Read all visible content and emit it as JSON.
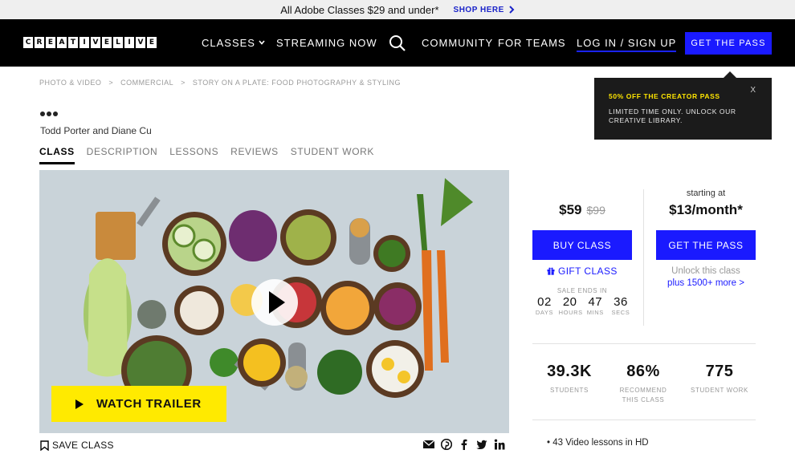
{
  "promo": {
    "text": "All Adobe Classes $29 and under*",
    "link": "SHOP HERE"
  },
  "nav": {
    "logo_letters": [
      "C",
      "R",
      "E",
      "A",
      "T",
      "I",
      "V",
      "E",
      "L",
      "I",
      "V",
      "E"
    ],
    "classes": "CLASSES",
    "streaming": "STREAMING NOW",
    "community": "COMMUNITY",
    "teams": "FOR TEAMS",
    "login": "LOG IN / SIGN UP",
    "get_pass": "GET THE PASS"
  },
  "breadcrumbs": [
    "PHOTO & VIDEO",
    ">",
    "COMMERCIAL",
    ">",
    "STORY ON A PLATE: FOOD PHOTOGRAPHY & STYLING"
  ],
  "popup": {
    "title": "50% OFF THE CREATOR PASS",
    "text": "LIMITED TIME ONLY. UNLOCK OUR CREATIVE LIBRARY.",
    "close": "X"
  },
  "authors": "Todd Porter and Diane Cu",
  "tabs": [
    "CLASS",
    "DESCRIPTION",
    "LESSONS",
    "REVIEWS",
    "STUDENT WORK"
  ],
  "hero": {
    "trailer": "WATCH TRAILER"
  },
  "save_class": "SAVE CLASS",
  "pricing": {
    "price": "$59",
    "old_price": "$99",
    "starting": "starting at",
    "monthly": "$13/month*",
    "buy": "BUY CLASS",
    "get_pass": "GET THE PASS",
    "gift": "GIFT CLASS",
    "sale_ends": "SALE ENDS IN",
    "countdown": [
      {
        "num": "02",
        "label": "DAYS"
      },
      {
        "num": "20",
        "label": "HOURS"
      },
      {
        "num": "47",
        "label": "MINS"
      },
      {
        "num": "36",
        "label": "SECS"
      }
    ],
    "unlock": "Unlock this class",
    "more": "plus 1500+ more >"
  },
  "stats": [
    {
      "value": "39.3K",
      "label": "STUDENTS"
    },
    {
      "value": "86%",
      "label": "RECOMMEND THIS CLASS"
    },
    {
      "value": "775",
      "label": "STUDENT WORK"
    }
  ],
  "features": [
    "43 Video lessons in HD"
  ],
  "colors": {
    "accent": "#1a1aff",
    "yellow": "#ffea00",
    "nav_bg": "#000000"
  }
}
